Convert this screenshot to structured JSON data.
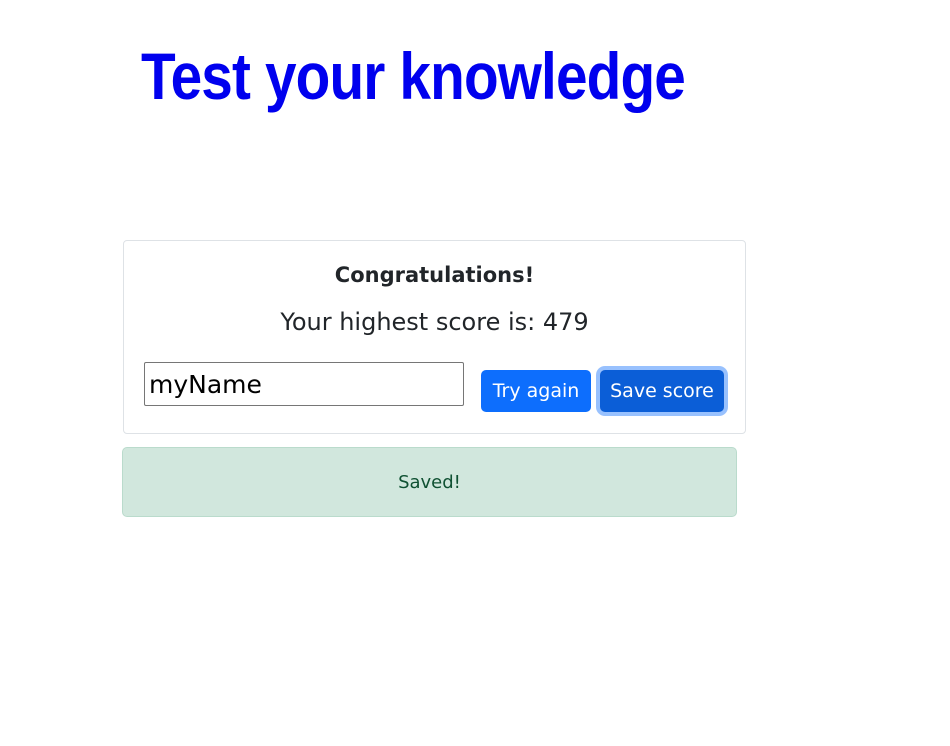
{
  "header": {
    "title": "Test your knowledge",
    "title_color": "#0000ee"
  },
  "result_card": {
    "heading": "Congratulations!",
    "score_text": "Your highest score is: 479",
    "name_input_value": "myName",
    "try_again_label": "Try again",
    "save_score_label": "Save score"
  },
  "alert": {
    "message": "Saved!",
    "status": "success",
    "background_color": "#d1e7dd",
    "text_color": "#0f5132"
  },
  "colors": {
    "primary": "#0d6efd",
    "primary_active": "#0b5ed7"
  }
}
